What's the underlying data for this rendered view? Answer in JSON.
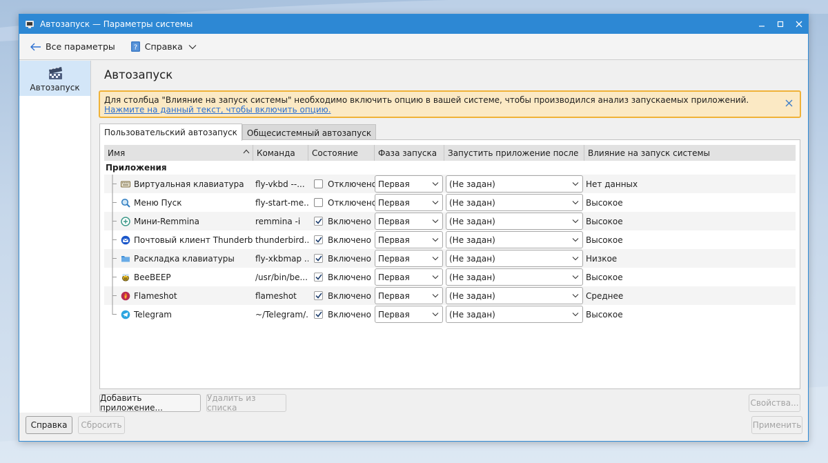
{
  "window": {
    "title": "Автозапуск — Параметры системы",
    "controls": [
      "minimize-icon",
      "maximize-icon",
      "close-icon"
    ]
  },
  "toolbar": {
    "back_label": "Все параметры",
    "help_label": "Справка"
  },
  "sidebar": {
    "items": [
      {
        "label": "Автозапуск",
        "icon": "autostart-icon"
      }
    ]
  },
  "page": {
    "title": "Автозапуск",
    "banner_text": "Для столбца \"Влияние на запуск системы\" необходимо включить опцию в вашей системе, чтобы производился анализ запускаемых приложений. ",
    "banner_link": "Нажмите на данный текст, чтобы включить опцию."
  },
  "tabs": [
    {
      "label": "Пользовательский автозапуск",
      "active": true
    },
    {
      "label": "Общесистемный автозапуск",
      "active": false
    }
  ],
  "table": {
    "columns": [
      "Имя",
      "Команда",
      "Состояние",
      "Фаза запуска",
      "Запустить приложение после",
      "Влияние на запуск системы"
    ],
    "group": "Приложения",
    "rows": [
      {
        "name": "Виртуальная клавиатура",
        "icon": "keyboard-icon",
        "command": "fly-vkbd --...",
        "checked": false,
        "state": "Отключено",
        "phase": "Первая",
        "after": "(Не задан)",
        "impact": "Нет данных"
      },
      {
        "name": "Меню Пуск",
        "icon": "magnifier-icon",
        "command": "fly-start-me...",
        "checked": false,
        "state": "Отключено",
        "phase": "Первая",
        "after": "(Не задан)",
        "impact": "Высокое"
      },
      {
        "name": "Мини-Remmina",
        "icon": "remmina-icon",
        "command": "remmina -i",
        "checked": true,
        "state": "Включено",
        "phase": "Первая",
        "after": "(Не задан)",
        "impact": "Высокое"
      },
      {
        "name": "Почтовый клиент Thunderbird",
        "icon": "thunderbird-icon",
        "command": "thunderbird...",
        "checked": true,
        "state": "Включено",
        "phase": "Первая",
        "after": "(Не задан)",
        "impact": "Высокое"
      },
      {
        "name": "Раскладка клавиатуры",
        "icon": "keyboard-layout-icon",
        "command": "fly-xkbmap ...",
        "checked": true,
        "state": "Включено",
        "phase": "Первая",
        "after": "(Не задан)",
        "impact": "Низкое"
      },
      {
        "name": "BeeBEEP",
        "icon": "beebeep-icon",
        "command": "/usr/bin/be...",
        "checked": true,
        "state": "Включено",
        "phase": "Первая",
        "after": "(Не задан)",
        "impact": "Высокое"
      },
      {
        "name": "Flameshot",
        "icon": "flameshot-icon",
        "command": "flameshot",
        "checked": true,
        "state": "Включено",
        "phase": "Первая",
        "after": "(Не задан)",
        "impact": "Среднее"
      },
      {
        "name": "Telegram",
        "icon": "telegram-icon",
        "command": "~/Telegram/...",
        "checked": true,
        "state": "Включено",
        "phase": "Первая",
        "after": "(Не задан)",
        "impact": "Высокое"
      }
    ]
  },
  "buttons": {
    "add": "Добавить приложение...",
    "remove": "Удалить из списка",
    "properties": "Свойства...",
    "help": "Справка",
    "reset": "Сбросить",
    "apply": "Применить"
  },
  "colors": {
    "titlebar": "#2d88d4",
    "banner_bg": "#fbe9c4",
    "banner_border": "#f0b237",
    "sidebar_selected": "#d3e6f8",
    "link": "#2b6fd1"
  }
}
